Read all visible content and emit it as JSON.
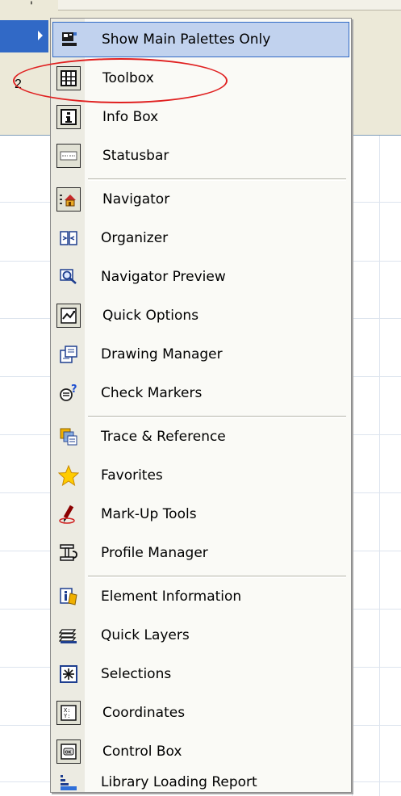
{
  "background": {
    "row_label": "2",
    "tick": "'"
  },
  "menu": {
    "items": [
      {
        "label": "Show Main Palettes Only",
        "icon": "palettes-icon",
        "highlighted": true,
        "checked": false
      },
      {
        "label": "Toolbox",
        "icon": "toolbox-icon",
        "checked": true
      },
      {
        "label": "Info Box",
        "icon": "info-box-icon",
        "checked": true
      },
      {
        "label": "Statusbar",
        "icon": "statusbar-icon",
        "checked": true
      },
      {
        "label": "Navigator",
        "icon": "navigator-icon",
        "checked": true
      },
      {
        "label": "Organizer",
        "icon": "organizer-icon",
        "checked": false
      },
      {
        "label": "Navigator Preview",
        "icon": "navigator-preview-icon",
        "checked": false
      },
      {
        "label": "Quick Options",
        "icon": "quick-options-icon",
        "checked": true
      },
      {
        "label": "Drawing Manager",
        "icon": "drawing-manager-icon",
        "checked": false
      },
      {
        "label": "Check Markers",
        "icon": "check-markers-icon",
        "checked": false
      },
      {
        "label": "Trace & Reference",
        "icon": "trace-reference-icon",
        "checked": false
      },
      {
        "label": "Favorites",
        "icon": "favorites-star-icon",
        "checked": false
      },
      {
        "label": "Mark-Up Tools",
        "icon": "markup-tools-icon",
        "checked": false
      },
      {
        "label": "Profile Manager",
        "icon": "profile-manager-icon",
        "checked": false
      },
      {
        "label": "Element Information",
        "icon": "element-information-icon",
        "checked": false
      },
      {
        "label": "Quick Layers",
        "icon": "quick-layers-icon",
        "checked": false
      },
      {
        "label": "Selections",
        "icon": "selections-icon",
        "checked": false
      },
      {
        "label": "Coordinates",
        "icon": "coordinates-icon",
        "checked": true
      },
      {
        "label": "Control Box",
        "icon": "control-box-icon",
        "checked": true
      },
      {
        "label": "Library Loading Report",
        "icon": "library-loading-report-icon",
        "checked": false
      }
    ]
  },
  "annotation": {
    "color": "#e02020",
    "target": "Toolbox"
  },
  "colors": {
    "highlight_bg": "#c1d2ee",
    "highlight_border": "#316ac5",
    "parent_selected": "#3169c6"
  }
}
